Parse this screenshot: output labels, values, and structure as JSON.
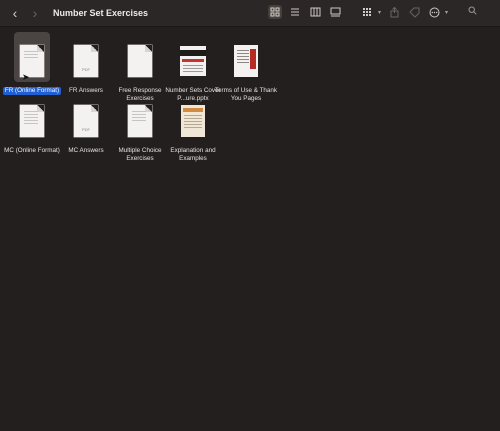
{
  "window": {
    "title": "Number Set Exercises"
  },
  "toolbar": {
    "icons": [
      "back-icon",
      "forward-icon",
      "icon-view-icon",
      "list-view-icon",
      "column-view-icon",
      "gallery-view-icon",
      "group-icon",
      "share-icon",
      "tag-icon",
      "more-icon",
      "search-icon"
    ],
    "back_glyph": "‹",
    "forward_glyph": "›"
  },
  "files": [
    {
      "label": "FR (Online Format)",
      "type": "doc",
      "selected": true
    },
    {
      "label": "FR Answers",
      "type": "pdf"
    },
    {
      "label": "Free Response Exercises",
      "type": "doc"
    },
    {
      "label": "Number Sets Cover P...ure.pptx",
      "type": "pptx"
    },
    {
      "label": "Terms of Use & Thank You Pages",
      "type": "terms"
    },
    {
      "label": "MC (Online Format)",
      "type": "doc"
    },
    {
      "label": "MC Answers",
      "type": "pdf"
    },
    {
      "label": "Multiple Choice Exercises",
      "type": "doc"
    },
    {
      "label": "Explanation and Examples",
      "type": "explain"
    }
  ],
  "pdf_tag": "PDF",
  "colors": {
    "selection": "#1f5fd3",
    "background": "#231f1e"
  }
}
